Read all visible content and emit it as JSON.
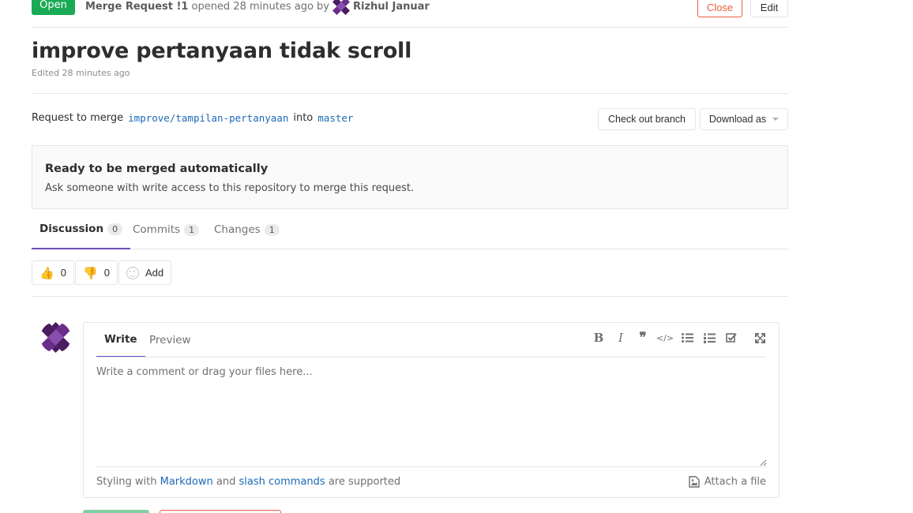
{
  "header": {
    "status": "Open",
    "mr_ref": "Merge Request !1",
    "opened_text": "opened 28 minutes ago by",
    "author": "Rizhul Januar",
    "close_label": "Close",
    "edit_label": "Edit"
  },
  "mr": {
    "title": "improve pertanyaan tidak scroll",
    "edited": "Edited 28 minutes ago",
    "request_prefix": "Request to merge",
    "source_branch": "improve/tampilan-pertanyaan",
    "into": "into",
    "target_branch": "master",
    "checkout_label": "Check out branch",
    "download_label": "Download as"
  },
  "widget": {
    "title": "Ready to be merged automatically",
    "description": "Ask someone with write access to this repository to merge this request."
  },
  "tabs": [
    {
      "label": "Discussion",
      "count": "0"
    },
    {
      "label": "Commits",
      "count": "1"
    },
    {
      "label": "Changes",
      "count": "1"
    }
  ],
  "awards": {
    "thumbs_up": "0",
    "thumbs_down": "0",
    "add_label": "Add"
  },
  "comment_form": {
    "write_tab": "Write",
    "preview_tab": "Preview",
    "placeholder": "Write a comment or drag your files here...",
    "footer_prefix": "Styling with",
    "markdown_link": "Markdown",
    "footer_and": "and",
    "slash_link": "slash commands",
    "footer_suffix": "are supported",
    "attach_label": "Attach a file",
    "toolbar_icons": [
      "bold-icon",
      "italic-icon",
      "quote-icon",
      "code-icon",
      "bullet-list-icon",
      "numbered-list-icon",
      "task-list-icon",
      "fullscreen-icon"
    ]
  },
  "colors": {
    "open_green": "#1aaa55",
    "close_orange": "#e75e40",
    "link_blue": "#1b69b6",
    "active_tab_purple": "#6b4fbb",
    "avatar_purple": "#4a1c62"
  }
}
